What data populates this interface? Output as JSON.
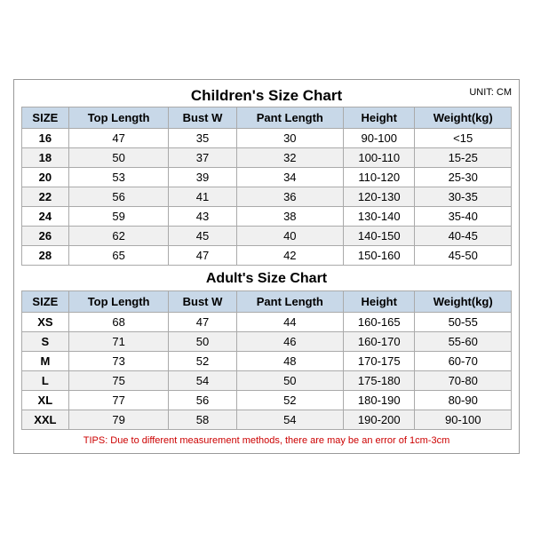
{
  "chartTitle": "Children's Size Chart",
  "unitLabel": "UNIT: CM",
  "children": {
    "headers": [
      "SIZE",
      "Top Length",
      "Bust W",
      "Pant Length",
      "Height",
      "Weight(kg)"
    ],
    "rows": [
      [
        "16",
        "47",
        "35",
        "30",
        "90-100",
        "<15"
      ],
      [
        "18",
        "50",
        "37",
        "32",
        "100-110",
        "15-25"
      ],
      [
        "20",
        "53",
        "39",
        "34",
        "110-120",
        "25-30"
      ],
      [
        "22",
        "56",
        "41",
        "36",
        "120-130",
        "30-35"
      ],
      [
        "24",
        "59",
        "43",
        "38",
        "130-140",
        "35-40"
      ],
      [
        "26",
        "62",
        "45",
        "40",
        "140-150",
        "40-45"
      ],
      [
        "28",
        "65",
        "47",
        "42",
        "150-160",
        "45-50"
      ]
    ]
  },
  "adultsTitle": "Adult's Size Chart",
  "adults": {
    "headers": [
      "SIZE",
      "Top Length",
      "Bust W",
      "Pant Length",
      "Height",
      "Weight(kg)"
    ],
    "rows": [
      [
        "XS",
        "68",
        "47",
        "44",
        "160-165",
        "50-55"
      ],
      [
        "S",
        "71",
        "50",
        "46",
        "160-170",
        "55-60"
      ],
      [
        "M",
        "73",
        "52",
        "48",
        "170-175",
        "60-70"
      ],
      [
        "L",
        "75",
        "54",
        "50",
        "175-180",
        "70-80"
      ],
      [
        "XL",
        "77",
        "56",
        "52",
        "180-190",
        "80-90"
      ],
      [
        "XXL",
        "79",
        "58",
        "54",
        "190-200",
        "90-100"
      ]
    ]
  },
  "tips": "TIPS: Due to different measurement methods, there are may be an error of 1cm-3cm"
}
